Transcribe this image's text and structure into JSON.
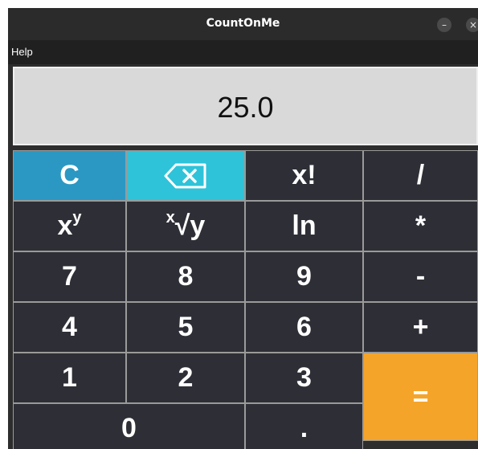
{
  "window": {
    "title": "CountOnMe",
    "minimize_label": "–",
    "close_label": "×"
  },
  "menu": {
    "help": "Help"
  },
  "display": {
    "value": "25.0"
  },
  "keys": {
    "clear": "C",
    "backspace_icon": "backspace-icon",
    "factorial": "x!",
    "divide": "/",
    "power_base": "x",
    "power_exp": "y",
    "root_index": "x",
    "root_rest": "√y",
    "ln": "ln",
    "multiply": "*",
    "seven": "7",
    "eight": "8",
    "nine": "9",
    "minus": "-",
    "four": "4",
    "five": "5",
    "six": "6",
    "plus": "+",
    "one": "1",
    "two": "2",
    "three": "3",
    "equals": "=",
    "zero": "0",
    "decimal": "."
  },
  "colors": {
    "key_bg": "#2e2f36",
    "clear_bg": "#2b98c3",
    "backspace_bg": "#2ec3d9",
    "equals_bg": "#f5a42a",
    "display_bg": "#d9d9d9"
  }
}
